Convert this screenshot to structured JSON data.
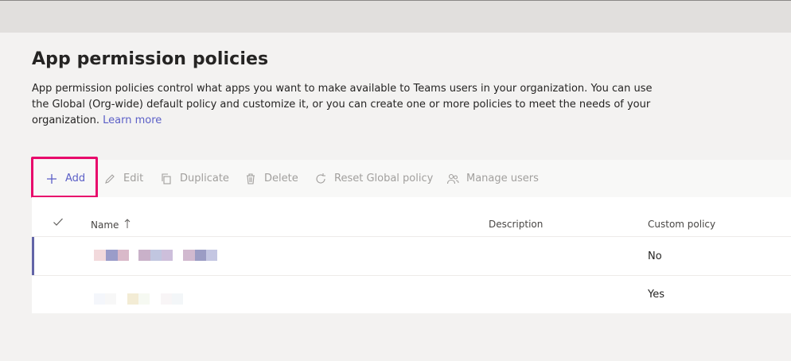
{
  "header": {
    "title": "App permission policies",
    "description": "App permission policies control what apps you want to make available to Teams users in your organization. You can use the Global (Org-wide) default policy and customize it, or you can create one or more policies to meet the needs of your organization.",
    "learn_more": "Learn more"
  },
  "toolbar": {
    "add": "Add",
    "edit": "Edit",
    "duplicate": "Duplicate",
    "delete": "Delete",
    "reset": "Reset Global policy",
    "manage": "Manage users"
  },
  "table": {
    "columns": {
      "name": "Name",
      "description": "Description",
      "custom": "Custom policy"
    },
    "rows": [
      {
        "name": "",
        "description": "",
        "custom": "No"
      },
      {
        "name": "",
        "description": "",
        "custom": "Yes"
      }
    ]
  },
  "colors": {
    "accent": "#5b5fc7",
    "highlight_box": "#e8086b"
  },
  "icons": [
    "plus-icon",
    "pencil-icon",
    "copy-icon",
    "trash-icon",
    "refresh-icon",
    "people-icon",
    "checkmark-icon",
    "sort-up-icon"
  ]
}
